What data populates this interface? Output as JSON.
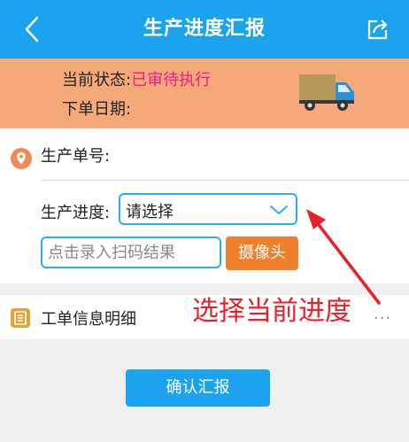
{
  "header": {
    "title": "生产进度汇报",
    "back_icon": "back-chevron-icon",
    "share_icon": "share-icon"
  },
  "status": {
    "status_label": "当前状态:",
    "status_value": "已审待执行",
    "order_date_label": "下单日期:",
    "truck_icon": "truck-icon"
  },
  "form": {
    "order_number_label": "生产单号:",
    "progress_label": "生产进度:",
    "progress_select": {
      "selected": "请选择"
    },
    "scan_input": {
      "value": "",
      "placeholder": "点击录入扫码结果"
    },
    "camera_button": "摄像头"
  },
  "detail": {
    "label": "工单信息明细",
    "more": "..."
  },
  "confirm_button": "确认汇报",
  "annotation": {
    "text": "选择当前进度"
  },
  "colors": {
    "header_bg": "#1ba3ef",
    "status_bg": "#f5a978",
    "status_value": "#e91e8c",
    "camera_button": "#f07e2b",
    "annotation": "#e8202a"
  }
}
